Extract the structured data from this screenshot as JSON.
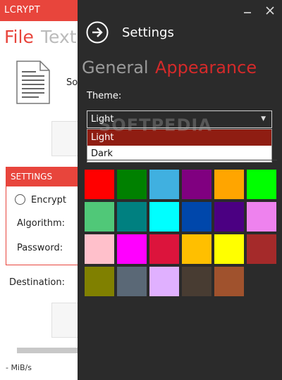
{
  "app": {
    "title": "LCRYPT",
    "tabs": [
      "File",
      "Text"
    ],
    "source_label": "So",
    "settings": {
      "header": "SETTINGS",
      "encrypt_label": "Encrypt",
      "algorithm_label": "Algorithm:",
      "password_label": "Password:"
    },
    "destination_label": "Destination:",
    "speed": "- MiB/s"
  },
  "flyout": {
    "title": "Settings",
    "tabs": {
      "general": "General",
      "appearance": "Appearance"
    },
    "theme_label": "Theme:",
    "theme_selected": "Light",
    "theme_options": [
      "Light",
      "Dark"
    ],
    "watermark": "SOFTPEDIA"
  },
  "colors": {
    "accent": "#e8453c",
    "flyout_bg": "#2b2b2b",
    "appearance_tab": "#d42a2a",
    "highlight_option": "#8f1d12",
    "swatches": [
      "#ff0000",
      "#008000",
      "#40b0e0",
      "#800080",
      "#ffa500",
      "#00ff00",
      "#50c878",
      "#008080",
      "#00ffff",
      "#0047ab",
      "#4b0082",
      "#ee82ee",
      "#ffc0cb",
      "#ff00ff",
      "#dc143c",
      "#ffbf00",
      "#ffff00",
      "#a52a2a",
      "#808000",
      "#5a6876",
      "#e0b0ff",
      "#483c32",
      "#a0522d"
    ]
  },
  "icons": {
    "back": "arrow-right-circle-icon",
    "minimize": "minimize-icon",
    "close": "close-icon",
    "document": "document-icon",
    "dropdown": "chevron-down-icon"
  }
}
